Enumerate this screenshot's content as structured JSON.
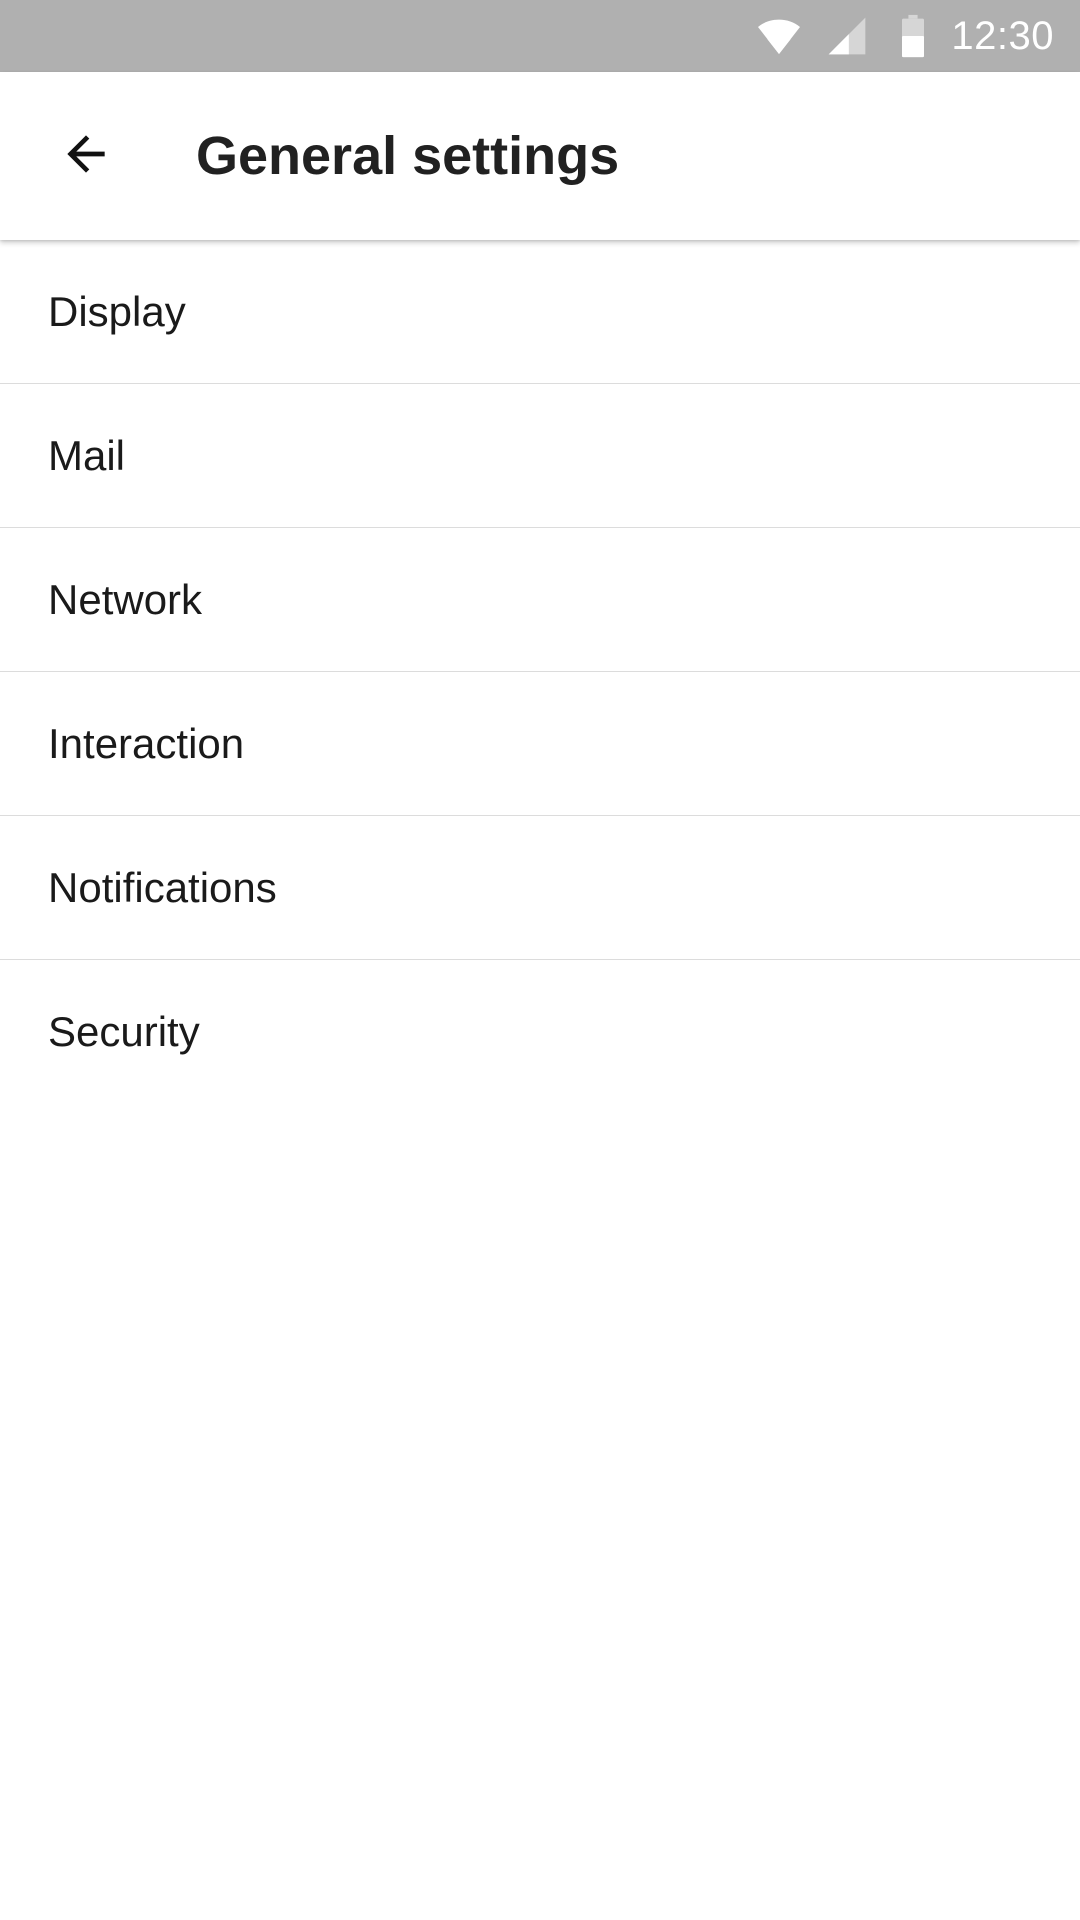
{
  "status_bar": {
    "time": "12:30",
    "icons": [
      "wifi-icon",
      "signal-icon",
      "battery-icon"
    ],
    "background": "#b0b0b0"
  },
  "app_bar": {
    "back_icon": "back-arrow-icon",
    "title": "General settings"
  },
  "settings": {
    "items": [
      {
        "label": "Display"
      },
      {
        "label": "Mail"
      },
      {
        "label": "Network"
      },
      {
        "label": "Interaction"
      },
      {
        "label": "Notifications"
      },
      {
        "label": "Security"
      }
    ]
  }
}
